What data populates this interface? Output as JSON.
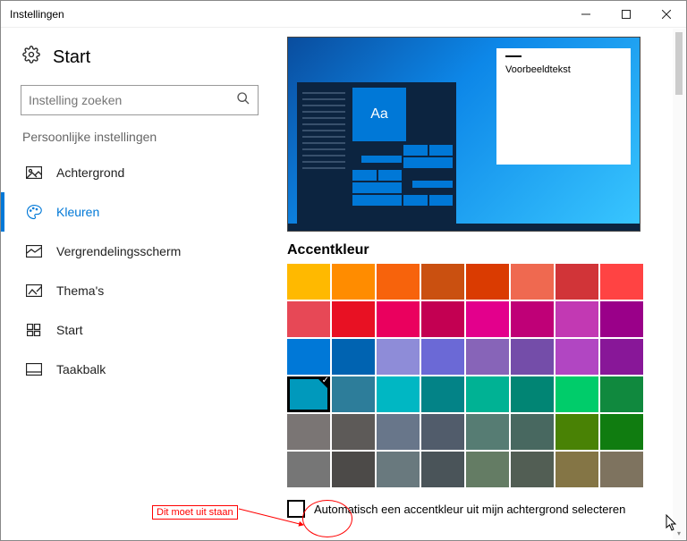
{
  "window": {
    "title": "Instellingen"
  },
  "sidebar": {
    "start_label": "Start",
    "search_placeholder": "Instelling zoeken",
    "subhead": "Persoonlijke instellingen",
    "items": [
      {
        "label": "Achtergrond"
      },
      {
        "label": "Kleuren"
      },
      {
        "label": "Vergrendelingsscherm"
      },
      {
        "label": "Thema's"
      },
      {
        "label": "Start"
      },
      {
        "label": "Taakbalk"
      }
    ]
  },
  "preview": {
    "tile_text": "Aa",
    "float_text": "Voorbeeldtekst"
  },
  "accent": {
    "heading": "Accentkleur",
    "checkbox_label": "Automatisch een accentkleur uit mijn achtergrond selecteren",
    "selected_index": 24,
    "colors": [
      "#ffb900",
      "#ff8c00",
      "#f7630c",
      "#ca5010",
      "#da3b01",
      "#ef6950",
      "#d13438",
      "#ff4343",
      "#e74856",
      "#e81123",
      "#ea005e",
      "#c30052",
      "#e3008c",
      "#bf0077",
      "#c239b3",
      "#9a0089",
      "#0078d7",
      "#0063b1",
      "#8e8cd8",
      "#6b69d6",
      "#8764b8",
      "#744da9",
      "#b146c2",
      "#881798",
      "#0099bc",
      "#2d7d9a",
      "#00b7c3",
      "#038387",
      "#00b294",
      "#018574",
      "#00cc6a",
      "#10893e",
      "#7a7574",
      "#5d5a58",
      "#68768a",
      "#515c6b",
      "#567c73",
      "#486860",
      "#498205",
      "#107c10",
      "#767676",
      "#4c4a48",
      "#69797e",
      "#4a5459",
      "#647c64",
      "#525e54",
      "#847545",
      "#7e735f"
    ]
  },
  "annotation": {
    "text": "Dit moet uit staan"
  }
}
